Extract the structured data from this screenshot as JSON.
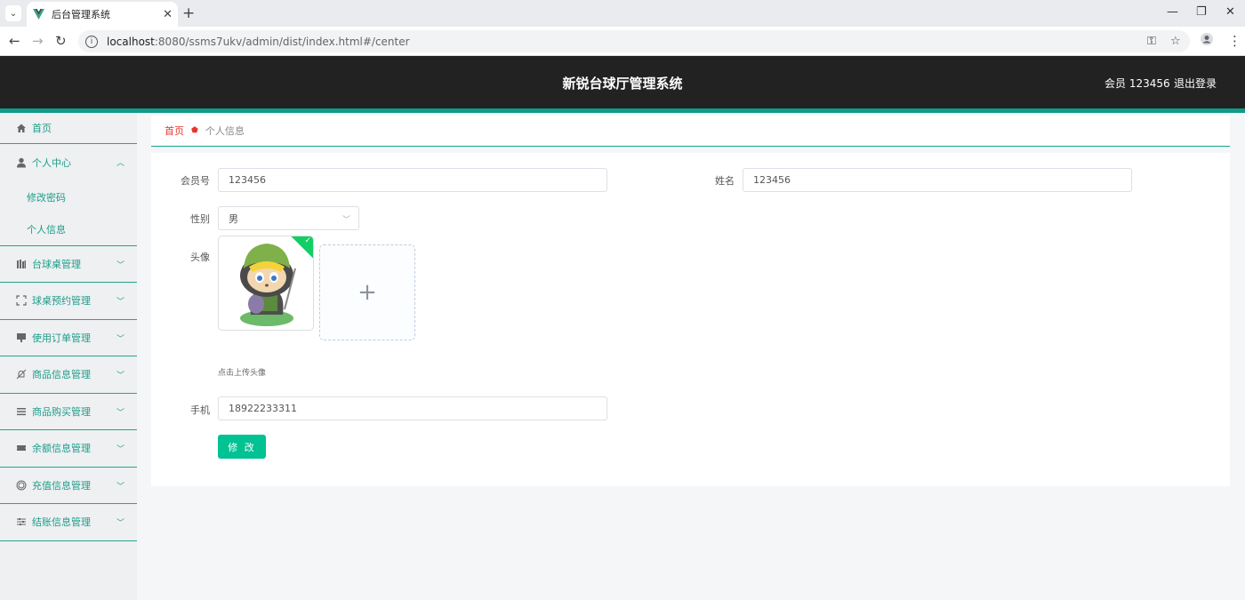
{
  "browser": {
    "tab_title": "后台管理系统",
    "url_host": "localhost",
    "url_rest": ":8080/ssms7ukv/admin/dist/index.html#/center",
    "icons": [
      "tab-list-icon",
      "vue-logo-icon",
      "close-icon",
      "new-tab-icon",
      "minimize-icon",
      "restore-icon",
      "window-close-icon",
      "back-icon",
      "forward-icon",
      "reload-icon",
      "site-info-icon",
      "password-key-icon",
      "bookmark-star-icon",
      "profile-icon",
      "more-menu-icon"
    ]
  },
  "header": {
    "title": "新锐台球厅管理系统",
    "user": "会员 123456",
    "logout": "退出登录",
    "accent": "#0f9b88"
  },
  "sidebar": {
    "items": [
      {
        "label": "首页",
        "icon": "home-icon"
      },
      {
        "label": "个人中心",
        "icon": "user-icon",
        "expanded": true,
        "children": [
          {
            "label": "修改密码"
          },
          {
            "label": "个人信息"
          }
        ]
      },
      {
        "label": "台球桌管理",
        "icon": "table-icon"
      },
      {
        "label": "球桌预约管理",
        "icon": "fullscreen-icon"
      },
      {
        "label": "使用订单管理",
        "icon": "order-icon"
      },
      {
        "label": "商品信息管理",
        "icon": "bell-off-icon"
      },
      {
        "label": "商品购买管理",
        "icon": "list-icon"
      },
      {
        "label": "余额信息管理",
        "icon": "ticket-icon"
      },
      {
        "label": "充值信息管理",
        "icon": "coin-icon"
      },
      {
        "label": "结账信息管理",
        "icon": "settings-sliders-icon"
      }
    ]
  },
  "breadcrumb": {
    "home": "首页",
    "current": "个人信息"
  },
  "form": {
    "member_no_label": "会员号",
    "member_no_value": "123456",
    "name_label": "姓名",
    "name_value": "123456",
    "gender_label": "性别",
    "gender_value": "男",
    "avatar_label": "头像",
    "upload_tip": "点击上传头像",
    "phone_label": "手机",
    "phone_value": "18922233311",
    "submit_label": "修 改",
    "submit_color": "#00c292"
  }
}
